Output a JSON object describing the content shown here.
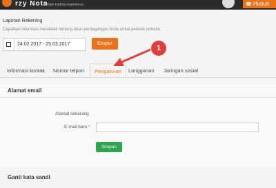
{
  "topbar": {
    "logo_text": "rzy Nota",
    "slogan": "Ultimate trading experience",
    "slogan2": "...",
    "button_label": "Hubun"
  },
  "report": {
    "section_title": "Laporan Rekening",
    "description": "Dapatkan informasi mendetail tentang akun perdagangan Anda untuk periode tertentu.",
    "date_range": "24.02.2017 - 25.03.2017",
    "export_label": "Ekspor"
  },
  "tabs": [
    {
      "label": "Informasi kontak"
    },
    {
      "label": "Nomor telpon"
    },
    {
      "label": "Pengaturan"
    },
    {
      "label": "Langganan"
    },
    {
      "label": "Jaringan sosial"
    }
  ],
  "active_tab": "Pengaturan",
  "callout": {
    "number": "1"
  },
  "email_section": {
    "title": "Alamat email",
    "current_label": "Alamat sekarang",
    "new_label": "E-mail baru",
    "required_mark": "*",
    "new_value": "",
    "save_label": "Simpan"
  },
  "password_section": {
    "title": "Ganti kata sandi"
  },
  "colors": {
    "accent": "#e8731a",
    "callout": "#e03d3d",
    "save": "#2ea44f"
  }
}
